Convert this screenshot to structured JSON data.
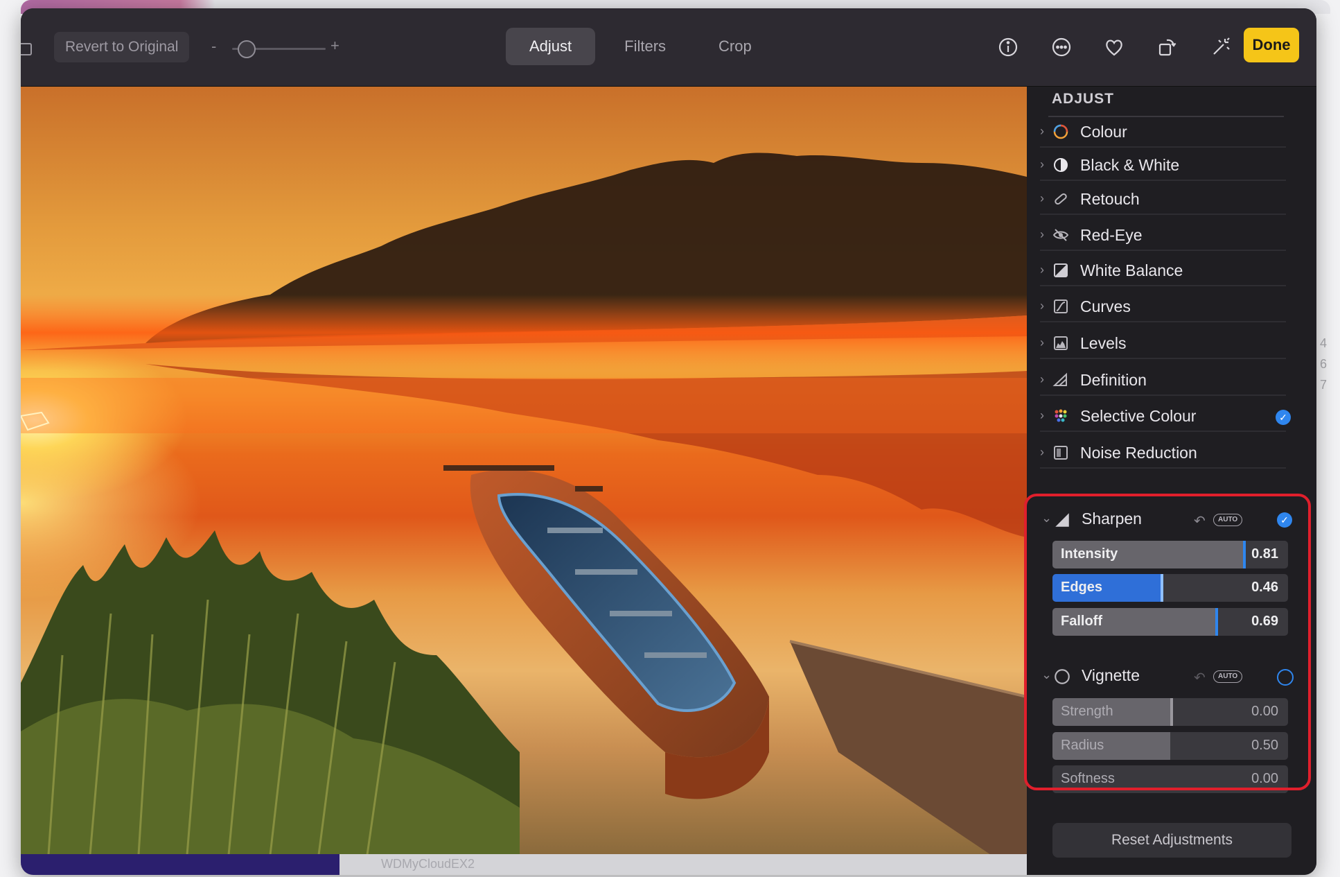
{
  "toolbar": {
    "revert_label": "Revert to Original",
    "zoom_minus": "-",
    "zoom_plus": "+",
    "tabs": [
      {
        "label": "Adjust",
        "active": true
      },
      {
        "label": "Filters",
        "active": false
      },
      {
        "label": "Crop",
        "active": false
      }
    ],
    "icons": [
      "info-icon",
      "more-icon",
      "heart-icon",
      "rotate-icon",
      "magic-wand-icon"
    ],
    "done_label": "Done",
    "done_color": "#f5c518"
  },
  "panel": {
    "title": "ADJUST",
    "items": [
      {
        "label": "Colour",
        "icon": "colour-circle-icon"
      },
      {
        "label": "Black & White",
        "icon": "half-circle-icon"
      },
      {
        "label": "Retouch",
        "icon": "bandage-icon"
      },
      {
        "label": "Red-Eye",
        "icon": "eye-icon"
      },
      {
        "label": "White Balance",
        "icon": "white-balance-icon"
      },
      {
        "label": "Curves",
        "icon": "curves-icon"
      },
      {
        "label": "Levels",
        "icon": "levels-icon"
      },
      {
        "label": "Definition",
        "icon": "triangle-icon"
      },
      {
        "label": "Selective Colour",
        "icon": "dots-icon",
        "enabled": true
      },
      {
        "label": "Noise Reduction",
        "icon": "noise-icon"
      }
    ],
    "sharpen": {
      "label": "Sharpen",
      "auto_label": "AUTO",
      "enabled": true,
      "sliders": [
        {
          "name": "Intensity",
          "value": "0.81",
          "level": 0.81
        },
        {
          "name": "Edges",
          "value": "0.46",
          "level": 0.46,
          "active": true
        },
        {
          "name": "Falloff",
          "value": "0.69",
          "level": 0.69
        }
      ]
    },
    "vignette": {
      "label": "Vignette",
      "auto_label": "AUTO",
      "enabled": false,
      "sliders": [
        {
          "name": "Strength",
          "value": "0.00",
          "level": 0.5
        },
        {
          "name": "Radius",
          "value": "0.50",
          "level": 0.5
        },
        {
          "name": "Softness",
          "value": "0.00",
          "level": 0.0
        }
      ]
    },
    "reset_label": "Reset Adjustments",
    "accent_color": "#2f86ee",
    "highlight_color": "#e01f2c"
  },
  "background": {
    "ghost_text": "WDMyCloudEX2",
    "edge_chars": [
      "4",
      "6",
      "7"
    ]
  }
}
